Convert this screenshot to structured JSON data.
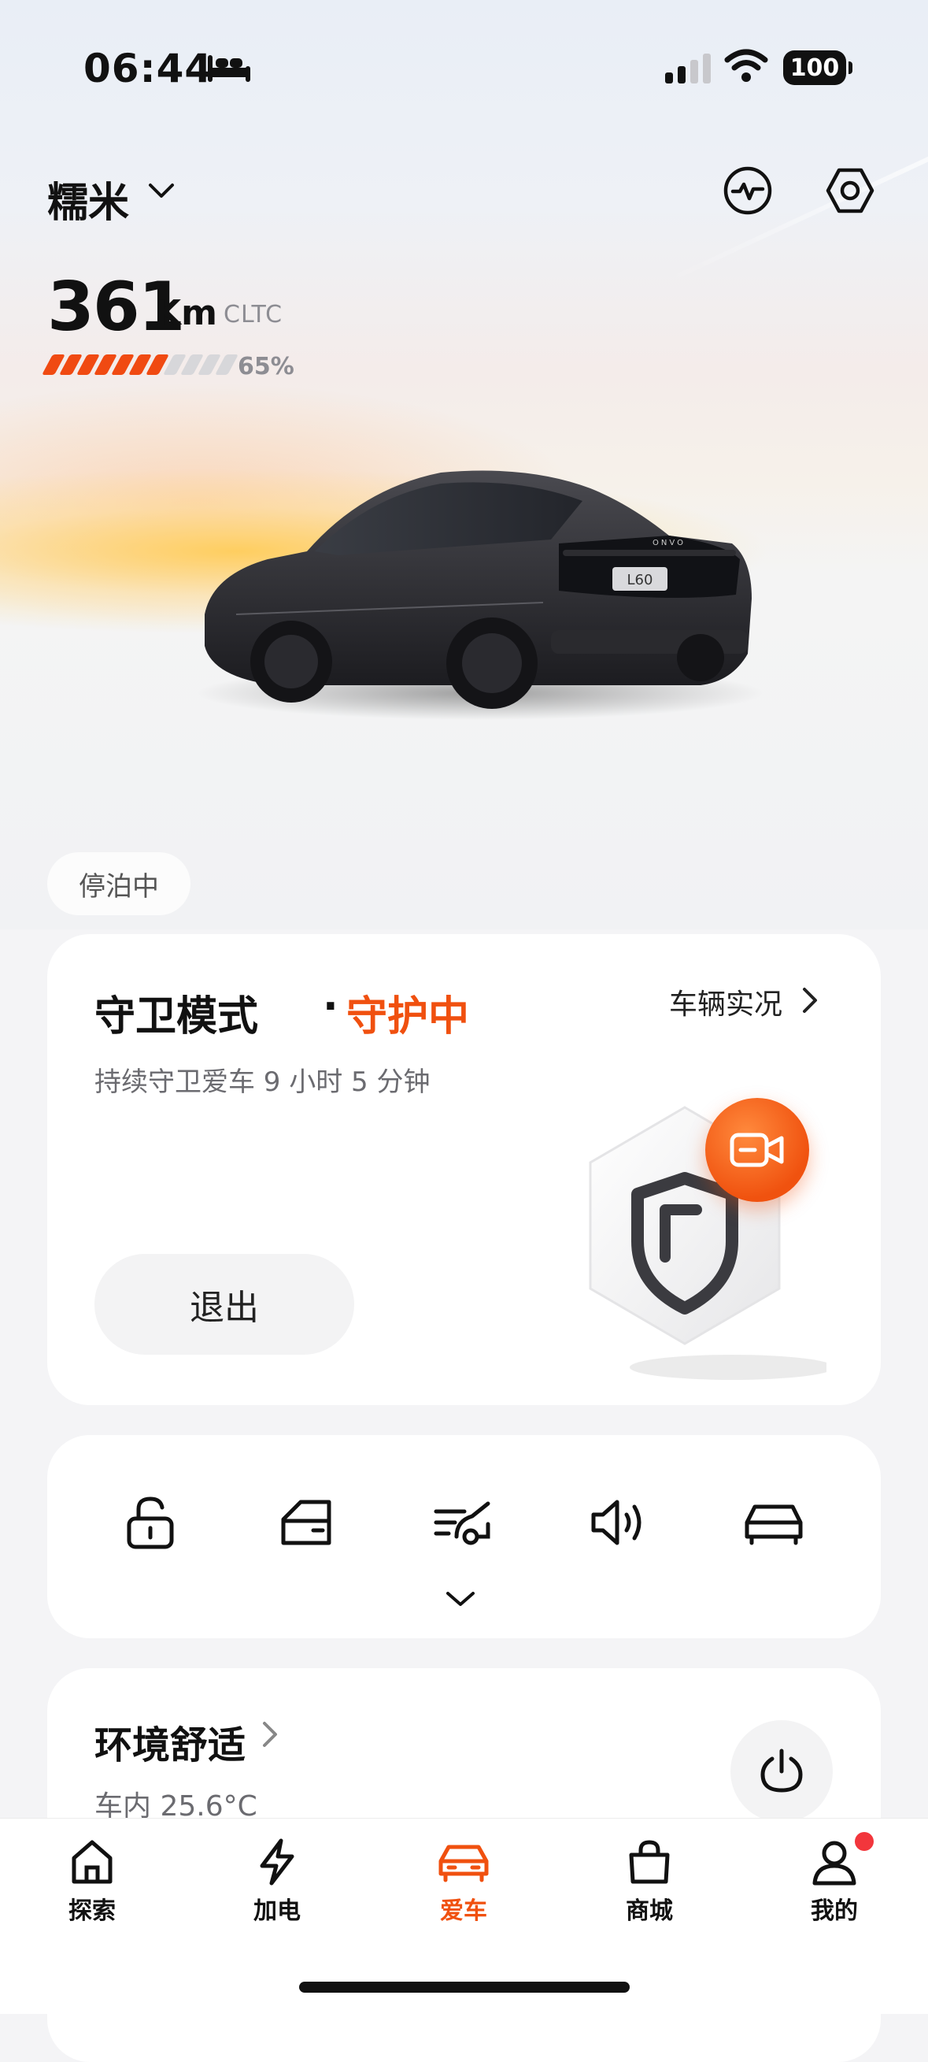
{
  "status_bar": {
    "time": "06:44",
    "battery": "100"
  },
  "header": {
    "car_name": "糯米"
  },
  "range": {
    "value": "361",
    "unit": "Km",
    "standard": "CLTC",
    "percent_label": "65%",
    "percent": 65
  },
  "car": {
    "plate": "L60",
    "brand": "ONVO"
  },
  "park_status": "停泊中",
  "guard_card": {
    "title": "守卫模式",
    "separator": "·",
    "status": "守护中",
    "vehicle_link": "车辆实况",
    "subtitle": "持续守卫爱车 9 小时 5 分钟",
    "exit_label": "退出"
  },
  "controls": {
    "items": [
      "lock-icon",
      "door-icon",
      "trunk-icon",
      "horn-icon",
      "car-icon"
    ]
  },
  "env_card": {
    "title": "环境舒适",
    "cabin_temp": "车内 25.6°C"
  },
  "tabs": [
    {
      "label": "探索",
      "icon": "home-icon"
    },
    {
      "label": "加电",
      "icon": "bolt-icon"
    },
    {
      "label": "爱车",
      "icon": "car-icon",
      "active": true
    },
    {
      "label": "商城",
      "icon": "bag-icon"
    },
    {
      "label": "我的",
      "icon": "person-icon"
    }
  ],
  "colors": {
    "accent": "#f0500f",
    "badge": "#f2363c"
  }
}
